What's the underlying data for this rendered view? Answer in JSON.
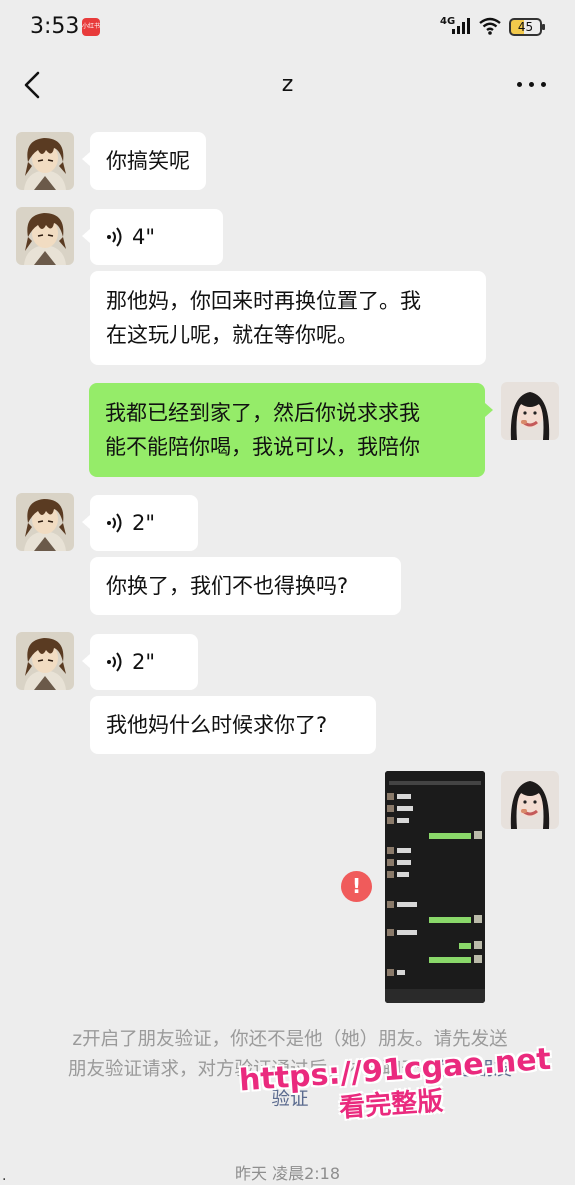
{
  "status_bar": {
    "time": "3:53",
    "notification_badge": "小红书",
    "network": "4G",
    "battery": "45"
  },
  "nav": {
    "title": "z"
  },
  "messages": [
    {
      "side": "left",
      "type": "text",
      "text": "你搞笑呢"
    },
    {
      "side": "left",
      "type": "voice",
      "duration": "4\""
    },
    {
      "side": "left",
      "type": "text",
      "lines": [
        "那他妈，你回来时再换位置了。我",
        "在这玩儿呢，就在等你呢。"
      ]
    },
    {
      "side": "right",
      "type": "text",
      "lines": [
        "我都已经到家了，然后你说求求我",
        "能不能陪你喝，我说可以，我陪你"
      ]
    },
    {
      "side": "left",
      "type": "voice",
      "duration": "2\""
    },
    {
      "side": "left",
      "type": "text",
      "text": "你换了，我们不也得换吗?"
    },
    {
      "side": "left",
      "type": "voice",
      "duration": "2\""
    },
    {
      "side": "left",
      "type": "text",
      "text": "我他妈什么时候求你了?"
    },
    {
      "side": "right",
      "type": "image",
      "status": "failed"
    }
  ],
  "system_notice": {
    "line1": "z开启了朋友验证，你还不是他（她）朋友。请先发送",
    "line2_prefix": "朋友验证请求，对方验证通过后，才能聊天。",
    "line2_link": "发送朋友",
    "line3_link": "验证"
  },
  "watermark": {
    "url": "https://91cgae.net",
    "caption": "看完整版"
  },
  "timestamp": "昨天 凌晨2:18",
  "colors": {
    "background": "#ededed",
    "my_bubble": "#95ec69",
    "their_bubble": "#ffffff",
    "error": "#f05b5b",
    "watermark": "#ea2a7e"
  }
}
